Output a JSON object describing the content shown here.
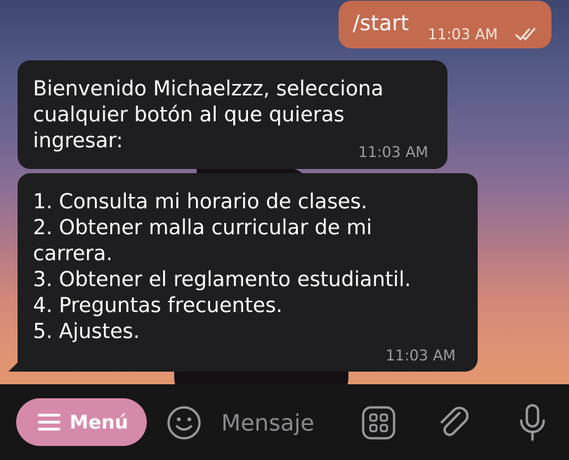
{
  "chat": {
    "messages": [
      {
        "direction": "outgoing",
        "lines": [
          "/start"
        ],
        "time": "11:03 AM",
        "status": "read"
      },
      {
        "direction": "incoming",
        "lines": [
          "Bienvenido Michaelzzz, selecciona",
          "cualquier botón al que quieras",
          "ingresar:"
        ],
        "time": "11:03 AM"
      },
      {
        "direction": "incoming",
        "lines": [
          "1. Consulta mi horario de clases.",
          "2. Obtener malla curricular de mi",
          "carrera.",
          "3. Obtener el reglamento estudiantil.",
          "4. Preguntas frecuentes.",
          "5. Ajustes."
        ],
        "time": "11:03 AM"
      }
    ]
  },
  "input_bar": {
    "menu_button_label": "Menú",
    "menu_icon": "hamburger-icon",
    "emoji_icon": "smiley-icon",
    "message_placeholder": "Mensaje",
    "message_value": "",
    "bot_commands_icon": "grid-icon",
    "attach_icon": "paperclip-icon",
    "mic_icon": "microphone-icon"
  },
  "colors": {
    "outgoing_bubble": "#c36a4f",
    "incoming_bubble": "#1e1e20",
    "menu_button": "#d68aaa",
    "bottom_bar": "#161616"
  }
}
